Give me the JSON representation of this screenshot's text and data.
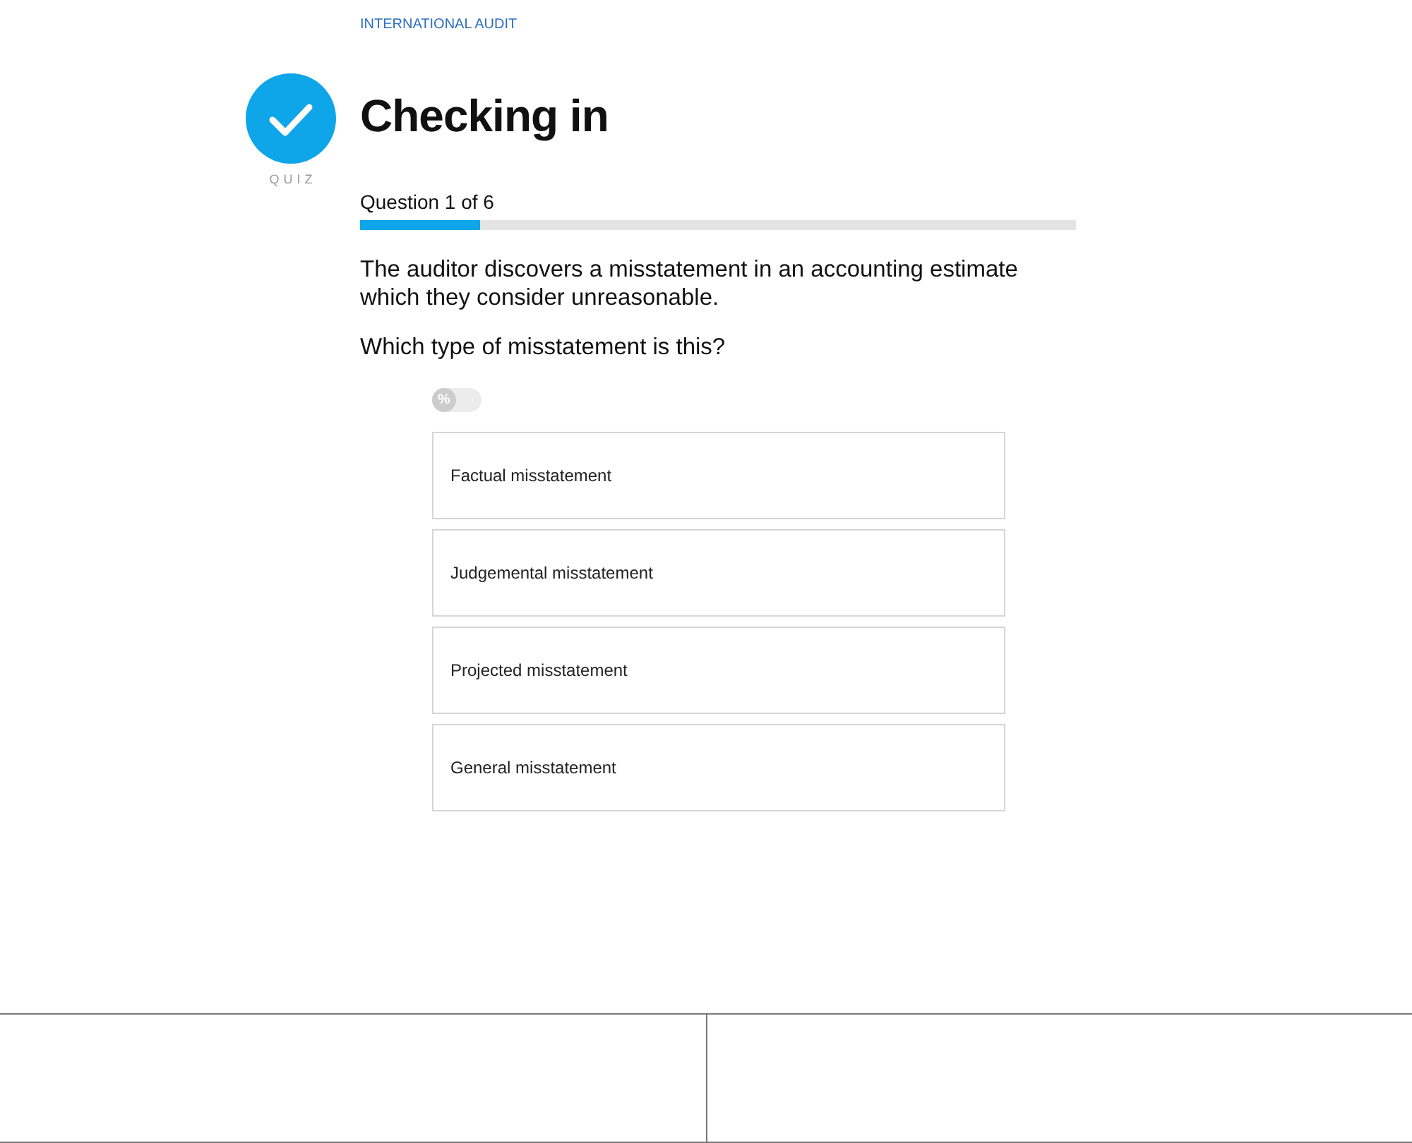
{
  "breadcrumb": "INTERNATIONAL AUDIT",
  "badge": {
    "label": "QUIZ"
  },
  "title": "Checking in",
  "progress": {
    "label": "Question 1 of 6",
    "level": 0.167
  },
  "question": {
    "stem": "The auditor discovers a misstatement in an accounting estimate which they consider unreasonable.",
    "prompt": "Which type of misstatement is this?"
  },
  "toggle": {
    "label": "%",
    "on": false
  },
  "options": [
    {
      "label": "Factual misstatement",
      "selected": false
    },
    {
      "label": "Judgemental misstatement",
      "selected": false
    },
    {
      "label": "Projected misstatement",
      "selected": false
    },
    {
      "label": "General misstatement",
      "selected": false
    }
  ],
  "footer": {
    "panels": [
      {
        "kind": "blank"
      },
      {
        "kind": "blank"
      }
    ]
  }
}
